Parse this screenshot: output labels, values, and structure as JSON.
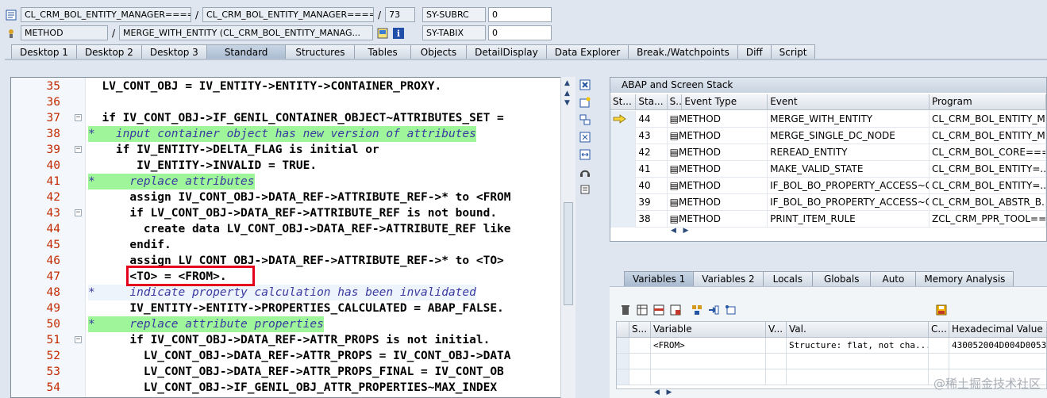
{
  "header": {
    "program_field_1": "CL_CRM_BOL_ENTITY_MANAGER====...",
    "program_field_2": "CL_CRM_BOL_ENTITY_MANAGER=====...",
    "line_number": "73",
    "event_type": "METHOD",
    "event_name": "MERGE_WITH_ENTITY (CL_CRM_BOL_ENTITY_MANAG...",
    "separator": "/",
    "sy_subrc_label": "SY-SUBRC",
    "sy_subrc_value": "0",
    "sy_tabix_label": "SY-TABIX",
    "sy_tabix_value": "0"
  },
  "tabs": [
    {
      "label": "Desktop 1"
    },
    {
      "label": "Desktop 2"
    },
    {
      "label": "Desktop 3"
    },
    {
      "label": "Standard"
    },
    {
      "label": "Structures"
    },
    {
      "label": "Tables"
    },
    {
      "label": "Objects"
    },
    {
      "label": "DetailDisplay"
    },
    {
      "label": "Data Explorer"
    },
    {
      "label": "Break./Watchpoints"
    },
    {
      "label": "Diff"
    },
    {
      "label": "Script"
    }
  ],
  "code_lines": [
    {
      "num": "35",
      "text": "  LV_CONT_OBJ = IV_ENTITY->ENTITY->CONTAINER_PROXY."
    },
    {
      "num": "36",
      "text": ""
    },
    {
      "num": "37",
      "text": "  if IV_CONT_OBJ->IF_GENIL_CONTAINER_OBJECT~ATTRIBUTES_SET ="
    },
    {
      "num": "38",
      "text": "*   input container object has new version of attributes"
    },
    {
      "num": "39",
      "text": "    if IV_ENTITY->DELTA_FLAG is initial or"
    },
    {
      "num": "40",
      "text": "       IV_ENTITY->INVALID = TRUE."
    },
    {
      "num": "41",
      "text": "*     replace attributes"
    },
    {
      "num": "42",
      "text": "      assign IV_CONT_OBJ->DATA_REF->ATTRIBUTE_REF->* to <FROM"
    },
    {
      "num": "43",
      "text": "      if LV_CONT_OBJ->DATA_REF->ATTRIBUTE_REF is not bound."
    },
    {
      "num": "44",
      "text": "        create data LV_CONT_OBJ->DATA_REF->ATTRIBUTE_REF like"
    },
    {
      "num": "45",
      "text": "      endif."
    },
    {
      "num": "46",
      "text": "      assign LV_CONT_OBJ->DATA_REF->ATTRIBUTE_REF->* to <TO>"
    },
    {
      "num": "47",
      "text": "      <TO> = <FROM>."
    },
    {
      "num": "48",
      "text": "*     indicate property calculation has been invalidated"
    },
    {
      "num": "49",
      "text": "      IV_ENTITY->ENTITY->PROPERTIES_CALCULATED = ABAP_FALSE."
    },
    {
      "num": "50",
      "text": "*     replace attribute properties"
    },
    {
      "num": "51",
      "text": "      if IV_CONT_OBJ->DATA_REF->ATTR_PROPS is not initial."
    },
    {
      "num": "52",
      "text": "        LV_CONT_OBJ->DATA_REF->ATTR_PROPS = IV_CONT_OBJ->DATA"
    },
    {
      "num": "53",
      "text": "        LV_CONT_OBJ->DATA_REF->ATTR_PROPS_FINAL = IV_CONT_OB"
    },
    {
      "num": "54",
      "text": "        LV_CONT_OBJ->IF_GENIL_OBJ_ATTR_PROPERTIES~MAX_INDEX"
    }
  ],
  "stack": {
    "title": "ABAP and Screen Stack",
    "columns": [
      "St...",
      "Sta...",
      "S...",
      "Event Type",
      "Event",
      "Program"
    ],
    "rows": [
      {
        "level": "44",
        "type": "METHOD",
        "event": "MERGE_WITH_ENTITY",
        "program": "CL_CRM_BOL_ENTITY_M"
      },
      {
        "level": "43",
        "type": "METHOD",
        "event": "MERGE_SINGLE_DC_NODE",
        "program": "CL_CRM_BOL_ENTITY_M"
      },
      {
        "level": "42",
        "type": "METHOD",
        "event": "REREAD_ENTITY",
        "program": "CL_CRM_BOL_CORE===..."
      },
      {
        "level": "41",
        "type": "METHOD",
        "event": "MAKE_VALID_STATE",
        "program": "CL_CRM_BOL_ENTITY=..."
      },
      {
        "level": "40",
        "type": "METHOD",
        "event": "IF_BOL_BO_PROPERTY_ACCESS~G...",
        "program": "CL_CRM_BOL_ENTITY=..."
      },
      {
        "level": "39",
        "type": "METHOD",
        "event": "IF_BOL_BO_PROPERTY_ACCESS~G...",
        "program": "CL_CRM_BOL_ABSTR_B..."
      },
      {
        "level": "38",
        "type": "METHOD",
        "event": "PRINT_ITEM_RULE",
        "program": "ZCL_CRM_PPR_TOOL==..."
      }
    ]
  },
  "variables": {
    "tabs": [
      {
        "label": "Variables 1"
      },
      {
        "label": "Variables 2"
      },
      {
        "label": "Locals"
      },
      {
        "label": "Globals"
      },
      {
        "label": "Auto"
      },
      {
        "label": "Memory Analysis"
      }
    ],
    "columns": [
      "S...",
      "Variable",
      "V...",
      "Val.",
      "C...",
      "Hexadecimal Value"
    ],
    "rows": [
      {
        "variable": "<FROM>",
        "value": "Structure: flat, not cha...",
        "hex": "430052004D004D0053"
      }
    ]
  },
  "watermark": "@稀土掘金技术社区"
}
